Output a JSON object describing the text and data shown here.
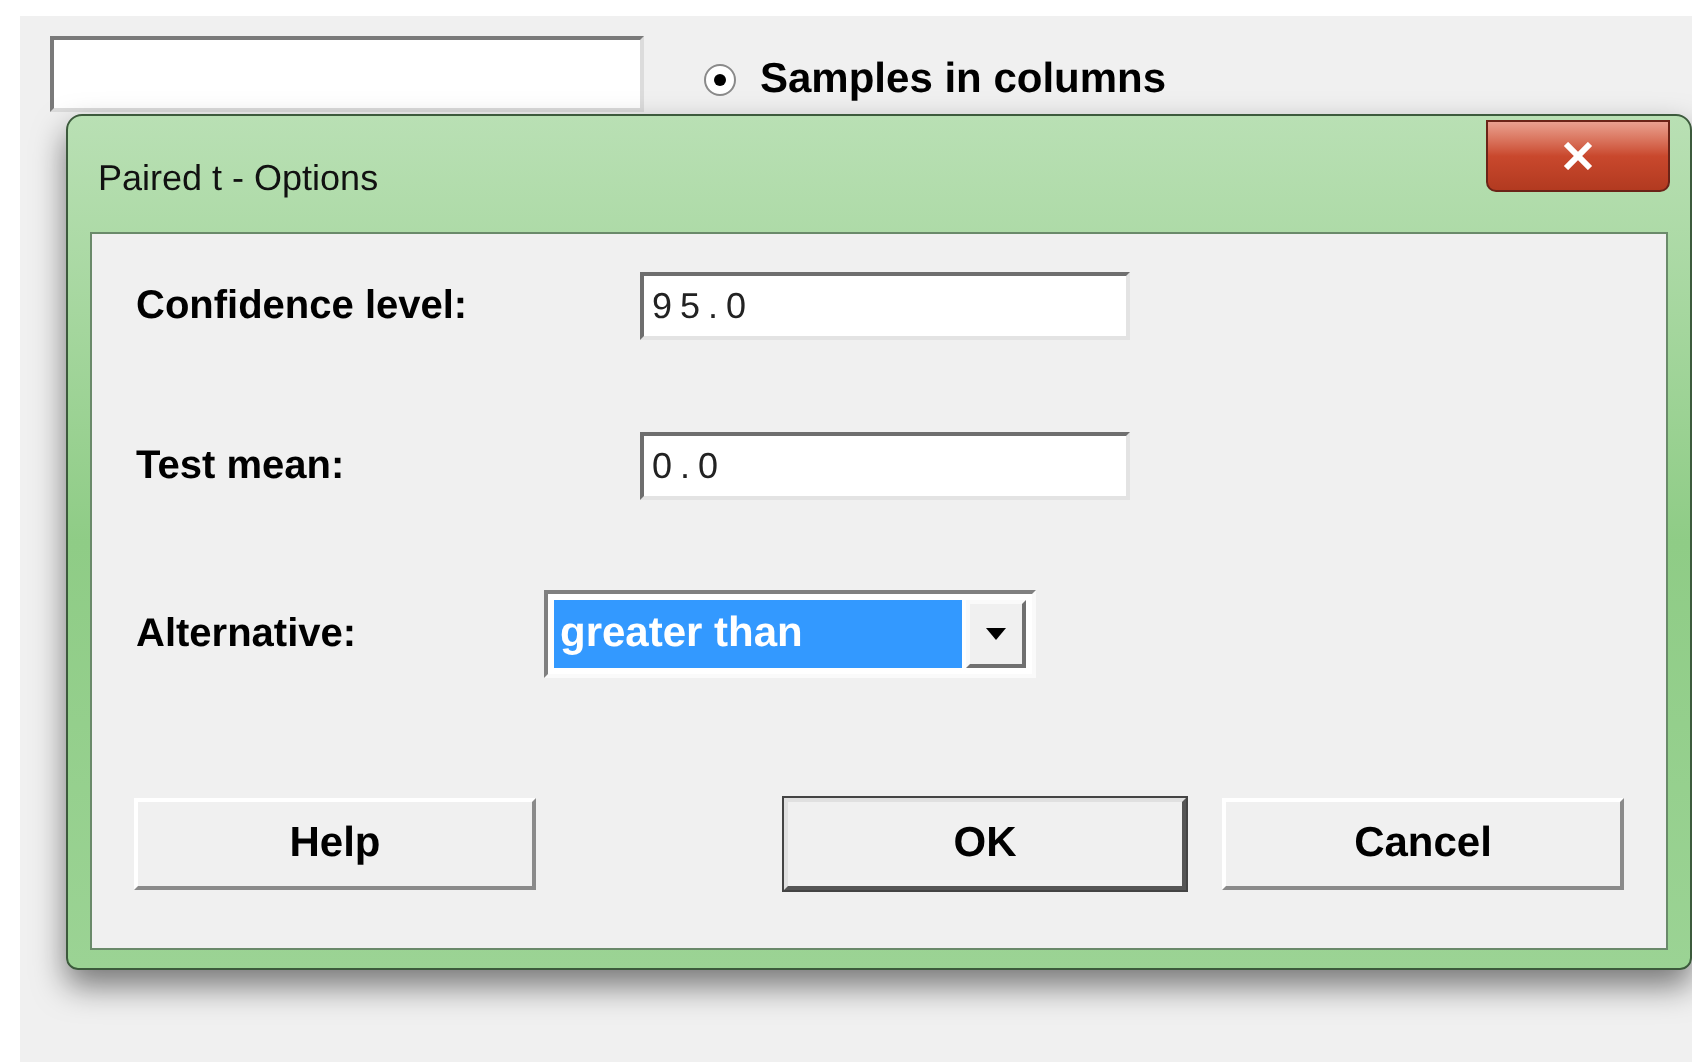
{
  "background_window": {
    "radio": {
      "label": "Samples in columns",
      "selected": true
    }
  },
  "dialog": {
    "title": "Paired t - Options",
    "fields": [
      {
        "label": "Confidence level:",
        "value": "95.0"
      },
      {
        "label": "Test mean:",
        "value": "0.0"
      }
    ],
    "alternative": {
      "label": "Alternative:",
      "value": "greater than",
      "highlighted": true
    },
    "buttons": [
      {
        "label": "Help",
        "default": false
      },
      {
        "label": "OK",
        "default": true
      },
      {
        "label": "Cancel",
        "default": false
      }
    ]
  }
}
